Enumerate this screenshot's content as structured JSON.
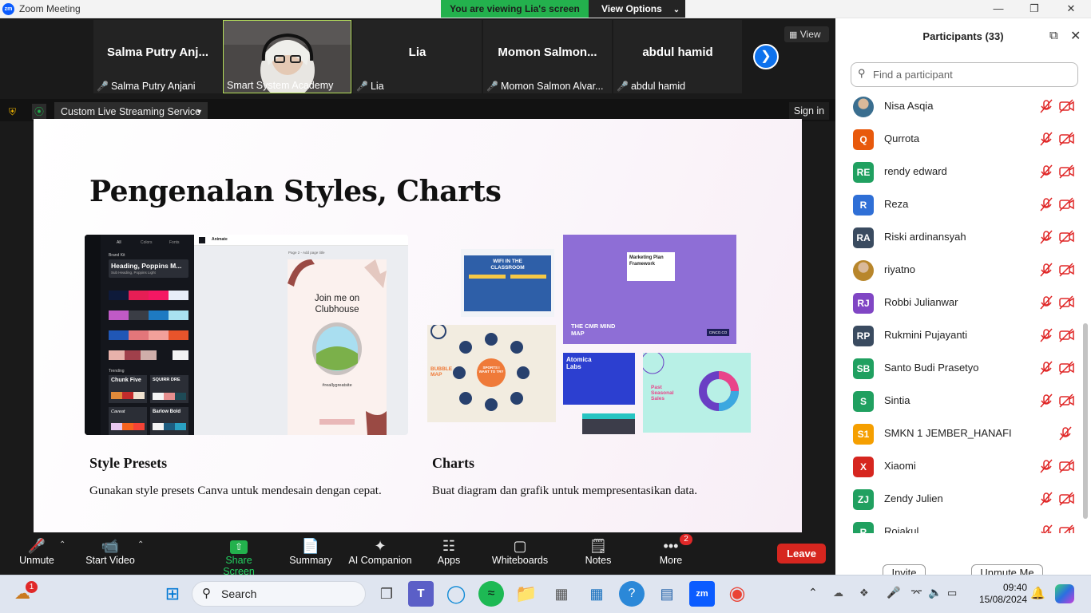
{
  "window": {
    "title": "Zoom Meeting",
    "logo": "zm"
  },
  "banner": {
    "viewing": "You are viewing Lia's screen",
    "view_options": "View Options"
  },
  "video_strip": {
    "tiles": [
      {
        "name": "Salma  Putry  Anj...",
        "label": "Salma Putry Anjani",
        "muted": true
      },
      {
        "name": "",
        "label": "Smart System Academy",
        "muted": false,
        "has_video": true
      },
      {
        "name": "Lia",
        "label": "Lia",
        "muted": true
      },
      {
        "name": "Momon  Salmon...",
        "label": "Momon Salmon Alvar...",
        "muted": true
      },
      {
        "name": "abdul hamid",
        "label": "abdul hamid",
        "muted": true
      }
    ],
    "view_label": "View"
  },
  "stream": {
    "service": "Custom Live Streaming Service",
    "sign_in": "Sign in"
  },
  "slide": {
    "title": "Pengenalan Styles, Charts",
    "left_heading": "Style Presets",
    "left_text": "Gunakan style presets Canva untuk mendesain dengan cepat.",
    "right_heading": "Charts",
    "right_text": "Buat diagram dan grafik untuk mempresentasikan data.",
    "canva": {
      "tabs": [
        "All",
        "Colors",
        "Fonts"
      ],
      "animate": "Animate",
      "page_label": "Page 2 - Add page title",
      "brand_kit": "Brand Kit",
      "heading_font": "Heading, Poppins M...",
      "subheading": "Sub Heading, Poppins Light",
      "join": "Join me on Clubhouse",
      "site": "#reallygreatsite",
      "trending": "Trending",
      "chunk": "Chunk Five",
      "squirrel": "SQUIRR DRE",
      "barlow": "Barlow Bold",
      "cover": "Caveat"
    },
    "charts": {
      "wifi": "WIFI IN THE CLASSROOM",
      "marketing": "Marketing Plan Framework",
      "cmr": "THE CMR MIND MAP",
      "bubble": "BUBBLE MAP",
      "sports": "SPORTS I WANT TO TRY",
      "atomica": "Atomica Labs",
      "past": "Past Seasonal Sales",
      "cinco": "CINCO.CO"
    }
  },
  "toolbar": {
    "unmute": "Unmute",
    "start_video": "Start Video",
    "share": "Share Screen",
    "summary": "Summary",
    "ai": "AI Companion",
    "apps": "Apps",
    "whiteboards": "Whiteboards",
    "notes": "Notes",
    "more": "More",
    "more_badge": "2",
    "leave": "Leave"
  },
  "participants": {
    "title": "Participants (33)",
    "search_placeholder": "Find a participant",
    "list": [
      {
        "initials": "",
        "name": "Nisa Asqia",
        "color": "#3a6e8f",
        "photo": true,
        "cam_off": true
      },
      {
        "initials": "Q",
        "name": "Qurrota",
        "color": "#e8590c",
        "cam_off": true
      },
      {
        "initials": "RE",
        "name": "rendy edward",
        "color": "#20a060",
        "cam_off": true
      },
      {
        "initials": "R",
        "name": "Reza",
        "color": "#2f6fd6",
        "cam_off": true
      },
      {
        "initials": "RA",
        "name": "Riski ardinansyah",
        "color": "#3a4b60",
        "cam_off": true
      },
      {
        "initials": "",
        "name": "riyatno",
        "color": "#b8862b",
        "photo": true,
        "cam_off": true
      },
      {
        "initials": "RJ",
        "name": "Robbi Julianwar",
        "color": "#8046c4",
        "cam_off": true
      },
      {
        "initials": "RP",
        "name": "Rukmini Pujayanti",
        "color": "#3a4b60",
        "cam_off": true
      },
      {
        "initials": "SB",
        "name": "Santo Budi Prasetyo",
        "color": "#20a060",
        "cam_off": true
      },
      {
        "initials": "S",
        "name": "Sintia",
        "color": "#20a060",
        "cam_off": true
      },
      {
        "initials": "S1",
        "name": "SMKN 1 JEMBER_HANAFI",
        "color": "#f59f00",
        "cam_off": false
      },
      {
        "initials": "X",
        "name": "Xiaomi",
        "color": "#d6261f",
        "cam_off": true
      },
      {
        "initials": "ZJ",
        "name": "Zendy Julien",
        "color": "#20a060",
        "cam_off": true
      },
      {
        "initials": "R",
        "name": "Rojakul",
        "color": "#20a060",
        "cam_off": true
      }
    ],
    "invite": "Invite",
    "unmute_me": "Unmute Me"
  },
  "taskbar": {
    "search": "Search",
    "time": "09:40",
    "date": "15/08/2024",
    "weather_badge": "1",
    "icons": [
      "task-view-icon",
      "teams-icon",
      "edge-icon",
      "spotify-icon",
      "file-explorer-icon",
      "calculator-icon",
      "store-icon",
      "help-icon",
      "news-icon",
      "zoom-icon",
      "chrome-icon"
    ]
  },
  "colors": {
    "accent": "#0e72ed",
    "green": "#23b14d",
    "leave": "#d6261f"
  }
}
